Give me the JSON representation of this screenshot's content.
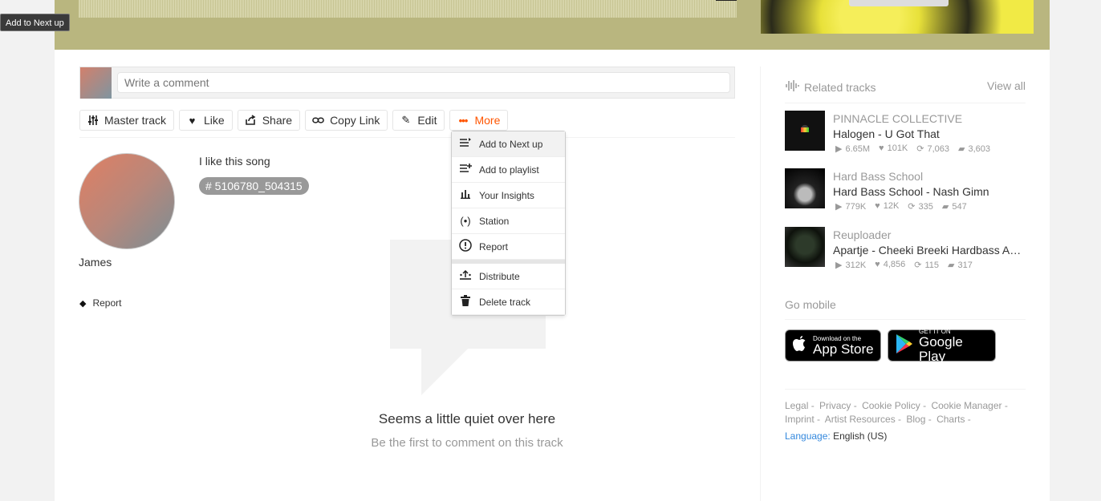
{
  "tooltip": "Add to Next up",
  "comment": {
    "placeholder": "Write a comment"
  },
  "actions": [
    {
      "label": "Master track",
      "icon": "sliders-icon"
    },
    {
      "label": "Like",
      "icon": "heart-icon"
    },
    {
      "label": "Share",
      "icon": "share-icon"
    },
    {
      "label": "Copy Link",
      "icon": "link-icon"
    },
    {
      "label": "Edit",
      "icon": "pencil-icon"
    },
    {
      "label": "More",
      "icon": "ellipsis-icon"
    }
  ],
  "more_menu": [
    {
      "label": "Add to Next up",
      "icon": "next-up-icon"
    },
    {
      "label": "Add to playlist",
      "icon": "playlist-add-icon"
    },
    {
      "label": "Your Insights",
      "icon": "insights-icon"
    },
    {
      "label": "Station",
      "icon": "station-icon"
    },
    {
      "label": "Report",
      "icon": "report-icon"
    },
    {
      "label": "Distribute",
      "icon": "distribute-icon"
    },
    {
      "label": "Delete track",
      "icon": "trash-icon"
    }
  ],
  "uploader": {
    "name": "James",
    "report": "Report"
  },
  "description": "I like this song",
  "tag": "# 5106780_504315",
  "empty_state": {
    "title": "Seems a little quiet over here",
    "subtitle": "Be the first to comment on this track"
  },
  "sidebar": {
    "related_title": "Related tracks",
    "view_all": "View all",
    "tracks": [
      {
        "artist": "PINNACLE COLLECTIVE",
        "title": "Halogen - U Got That",
        "plays": "6.65M",
        "likes": "101K",
        "reposts": "7,063",
        "comments": "3,603"
      },
      {
        "artist": "Hard Bass School",
        "title": "Hard Bass School - Nash Gimn",
        "plays": "779K",
        "likes": "12K",
        "reposts": "335",
        "comments": "547"
      },
      {
        "artist": "Reuploader",
        "title": "Apartje - Cheeki Breeki Hardbass A…",
        "plays": "312K",
        "likes": "4,856",
        "reposts": "115",
        "comments": "317"
      }
    ],
    "go_mobile": "Go mobile",
    "app_store": {
      "small": "Download on the",
      "big": "App Store"
    },
    "play_store": {
      "small": "GET IT ON",
      "big": "Google Play"
    },
    "footer_links": [
      "Legal -",
      "Privacy -",
      "Cookie Policy -",
      "Cookie Manager -",
      "Imprint -",
      "Artist Resources -",
      "Blog -",
      "Charts -"
    ],
    "language_label": "Language:",
    "language_value": "English (US)"
  }
}
